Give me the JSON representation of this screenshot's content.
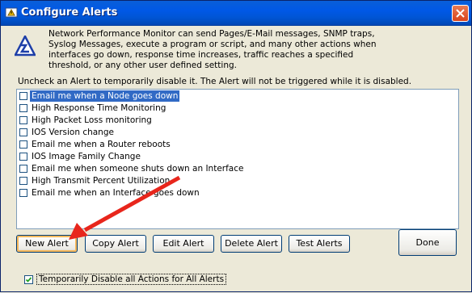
{
  "window": {
    "title": "Configure Alerts"
  },
  "description": "Network Performance Monitor can send Pages/E-Mail messages, SNMP traps, Syslog Messages, execute a program or script, and many other actions when interfaces go down, response time increases, traffic reaches a specified threshold, or any other user defined setting.",
  "instruction": "Uncheck an Alert to temporarily disable it. The Alert will not be triggered while it is disabled.",
  "alerts": [
    {
      "label": "Email me when a Node goes down",
      "checked": false,
      "selected": true
    },
    {
      "label": "High Response Time Monitoring",
      "checked": false,
      "selected": false
    },
    {
      "label": "High Packet Loss monitoring",
      "checked": false,
      "selected": false
    },
    {
      "label": "IOS Version change",
      "checked": false,
      "selected": false
    },
    {
      "label": "Email me when a Router reboots",
      "checked": false,
      "selected": false
    },
    {
      "label": "IOS Image Family Change",
      "checked": false,
      "selected": false
    },
    {
      "label": "Email me when someone shuts down an Interface",
      "checked": false,
      "selected": false
    },
    {
      "label": "High Transmit Percent Utilization",
      "checked": false,
      "selected": false
    },
    {
      "label": "Email me when an Interface goes down",
      "checked": false,
      "selected": false
    }
  ],
  "buttons": {
    "new_alert": "New Alert",
    "copy_alert": "Copy Alert",
    "edit_alert": "Edit Alert",
    "delete_alert": "Delete Alert",
    "test_alerts": "Test Alerts",
    "done": "Done"
  },
  "disable_all": {
    "label": "Temporarily Disable all Actions for All Alerts",
    "checked": true
  },
  "colors": {
    "selection": "#316ac5",
    "annotation_arrow": "#e8261c"
  }
}
